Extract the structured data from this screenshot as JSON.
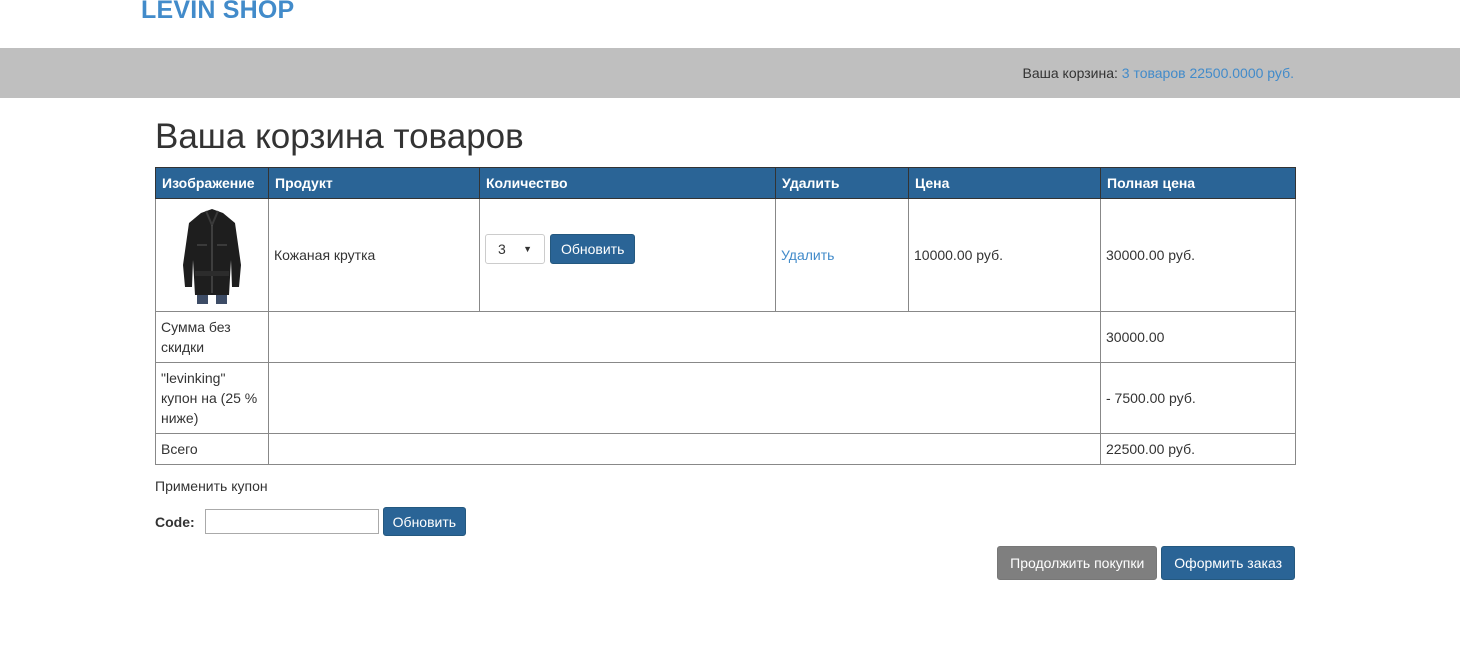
{
  "brand": "LEVIN SHOP",
  "header": {
    "cart_label": "Ваша корзина:",
    "cart_link": "3 товаров 22500.0000 руб."
  },
  "page_title": "Ваша корзина товаров",
  "table": {
    "headers": [
      "Изображение",
      "Продукт",
      "Количество",
      "Удалить",
      "Цена",
      "Полная цена"
    ],
    "item": {
      "image": "leather-jacket-image",
      "product": "Кожаная крутка",
      "quantity": "3",
      "update_label": "Обновить",
      "remove_label": "Удалить",
      "price": "10000.00 руб.",
      "total": "30000.00 руб."
    },
    "subtotal_label": "Сумма без скидки",
    "subtotal_value": "30000.00",
    "coupon_label": "\"levinking\" купон на (25 % ниже)",
    "coupon_value": "- 7500.00 руб.",
    "total_label": "Всего",
    "total_value": "22500.00 руб."
  },
  "coupon": {
    "title": "Применить купон",
    "code_label": "Code:",
    "code_value": "",
    "apply_label": "Обновить"
  },
  "actions": {
    "continue_label": "Продолжить покупки",
    "checkout_label": "Оформить заказ"
  },
  "colors": {
    "brand": "#428bca",
    "primary": "#2a6496",
    "subheader": "#bfbfbf",
    "secondary": "#7f7f7f"
  }
}
